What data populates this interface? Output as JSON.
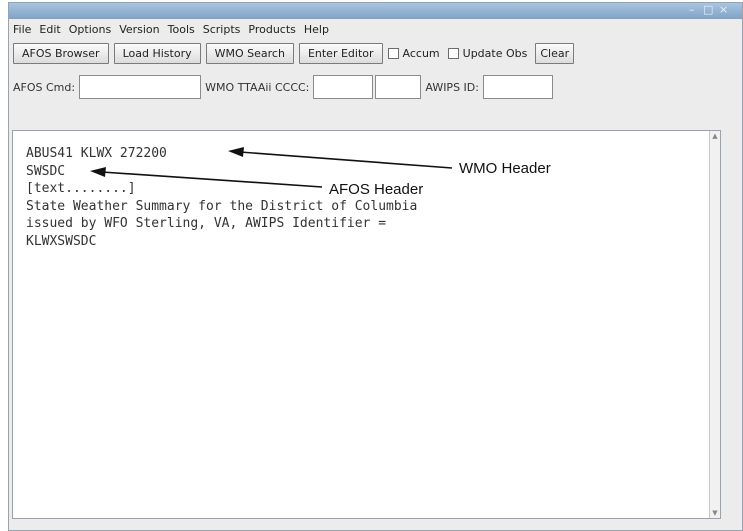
{
  "menu": [
    "File",
    "Edit",
    "Options",
    "Version",
    "Tools",
    "Scripts",
    "Products",
    "Help"
  ],
  "toolbar": {
    "afos_browser": "AFOS Browser",
    "load_history": "Load History",
    "wmo_search": "WMO Search",
    "enter_editor": "Enter Editor",
    "accum": "Accum",
    "update_obs": "Update Obs",
    "clear": "Clear"
  },
  "inputs": {
    "afos_cmd_label": "AFOS Cmd:",
    "wmo_label": "WMO TTAAii CCCC:",
    "awips_label": "AWIPS ID:"
  },
  "text_lines": [
    "ABUS41 KLWX 272200",
    "SWSDC",
    "[text........]",
    "State Weather Summary for the District of Columbia",
    "issued by WFO Sterling, VA, AWIPS Identifier =",
    "KLWXSWSDC"
  ],
  "annotations": {
    "wmo_header": "WMO Header",
    "afos_header": "AFOS Header"
  },
  "icons": [
    "minimize-icon",
    "maximize-icon",
    "close-icon",
    "checkbox-icon",
    "scroll-up-icon",
    "scroll-down-icon",
    "arrow-icon"
  ]
}
